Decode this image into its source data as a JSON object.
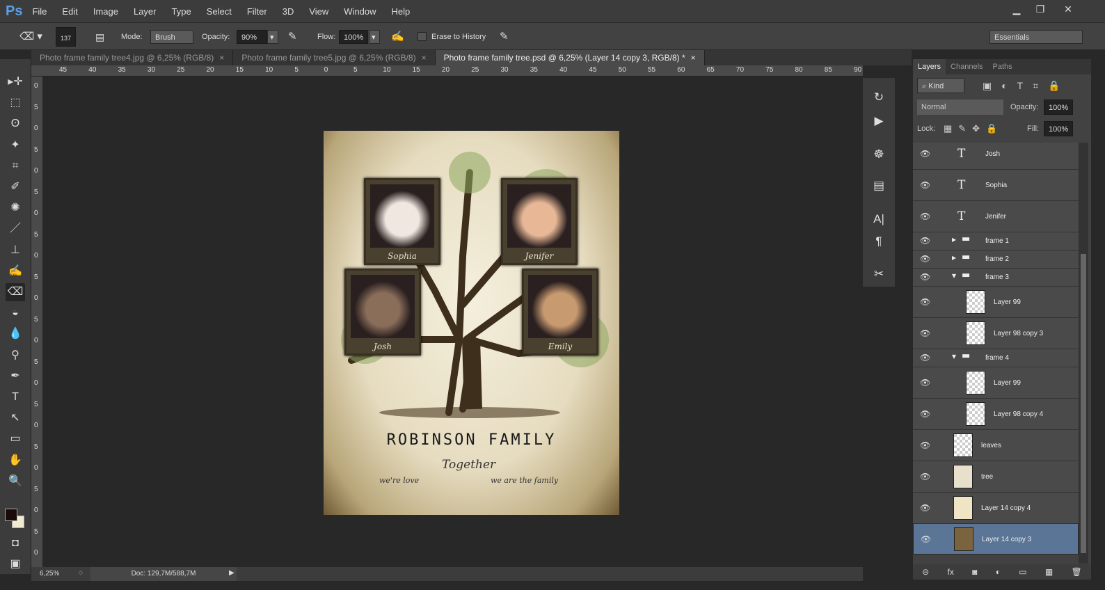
{
  "app": {
    "logo": "Ps",
    "menu": [
      "File",
      "Edit",
      "Image",
      "Layer",
      "Type",
      "Select",
      "Filter",
      "3D",
      "View",
      "Window",
      "Help"
    ]
  },
  "window": {
    "minimize": "▁",
    "restore": "❐",
    "close": "✕"
  },
  "options": {
    "brush_size": "137",
    "mode_label": "Mode:",
    "mode_value": "Brush",
    "opacity_label": "Opacity:",
    "opacity_value": "90%",
    "flow_label": "Flow:",
    "flow_value": "100%",
    "erase_history_label": "Erase to History",
    "erase_history_checked": false,
    "workspace": "Essentials"
  },
  "tabs": [
    {
      "label": "Photo frame family tree4.jpg @ 6,25% (RGB/8)",
      "active": false
    },
    {
      "label": "Photo frame family tree5.jpg @ 6,25% (RGB/8)",
      "active": false
    },
    {
      "label": "Photo frame family tree.psd @ 6,25% (Layer 14 copy 3, RGB/8) *",
      "active": true
    }
  ],
  "tab_close": "×",
  "ruler_top": [
    "45",
    "40",
    "35",
    "30",
    "25",
    "20",
    "15",
    "10",
    "5",
    "0",
    "5",
    "10",
    "15",
    "20",
    "25",
    "30",
    "35",
    "40",
    "45",
    "50",
    "55",
    "60",
    "65",
    "70",
    "75",
    "80",
    "85",
    "90"
  ],
  "ruler_left": [
    "0",
    "5",
    "0",
    "5",
    "0",
    "5",
    "0",
    "5",
    "0",
    "5",
    "0",
    "5",
    "0",
    "5",
    "0",
    "5",
    "0",
    "5",
    "0",
    "5",
    "0",
    "5",
    "0"
  ],
  "document": {
    "title": "Robinson family",
    "subtitle_main": "Together",
    "subtitle_left": "we're love",
    "subtitle_right": "we are the family",
    "frames": [
      {
        "name": "Sophia",
        "color": "#f0e8e0"
      },
      {
        "name": "Jenifer",
        "color": "#e8b896"
      },
      {
        "name": "Josh",
        "color": "#8a6e5a"
      },
      {
        "name": "Emily",
        "color": "#c89a70"
      }
    ]
  },
  "panel": {
    "tabs": [
      "Layers",
      "Channels",
      "Paths"
    ],
    "filter": "Kind",
    "blend_mode": "Normal",
    "opacity_label": "Opacity:",
    "opacity": "100%",
    "lock_label": "Lock:",
    "fill_label": "Fill:",
    "fill": "100%",
    "layers": [
      {
        "name": "Josh",
        "type": "text"
      },
      {
        "name": "Sophia",
        "type": "text"
      },
      {
        "name": "Jenifer",
        "type": "text"
      },
      {
        "name": "frame 1",
        "type": "group-collapsed"
      },
      {
        "name": "frame 2",
        "type": "group-collapsed"
      },
      {
        "name": "frame 3",
        "type": "group-open"
      },
      {
        "name": "Layer 99",
        "type": "child"
      },
      {
        "name": "Layer 98 copy 3",
        "type": "child"
      },
      {
        "name": "frame 4",
        "type": "group-open"
      },
      {
        "name": "Layer 99",
        "type": "child"
      },
      {
        "name": "Layer 98 copy 4",
        "type": "child"
      },
      {
        "name": "leaves",
        "type": "pixel"
      },
      {
        "name": "tree",
        "type": "pixel"
      },
      {
        "name": "Layer 14 copy 4",
        "type": "pixel"
      },
      {
        "name": "Layer 14 copy 3",
        "type": "pixel",
        "selected": true
      }
    ],
    "footer": [
      "⊝",
      "fx",
      "◙",
      "◐",
      "▭",
      "▦",
      "🗑"
    ]
  },
  "status": {
    "zoom": "6,25%",
    "doc": "Doc: 129,7M/588,7M"
  }
}
